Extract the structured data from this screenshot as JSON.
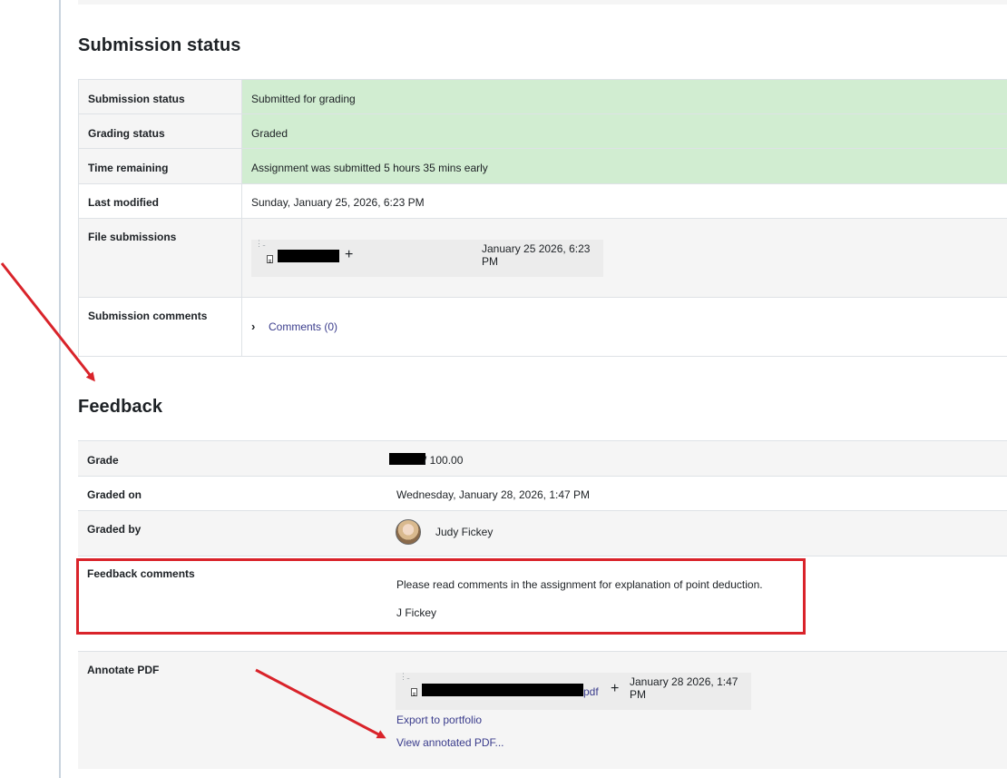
{
  "submission": {
    "heading": "Submission status",
    "rows": {
      "status_label": "Submission status",
      "status_value": "Submitted for grading",
      "grading_label": "Grading status",
      "grading_value": "Graded",
      "time_label": "Time remaining",
      "time_value": "Assignment was submitted 5 hours 35 mins early",
      "modified_label": "Last modified",
      "modified_value": "Sunday, January 25, 2026, 6:23 PM",
      "files_label": "File submissions",
      "file_date": "January 25 2026, 6:23 PM",
      "comments_label": "Submission comments",
      "comments_link": "Comments (0)"
    }
  },
  "feedback": {
    "heading": "Feedback",
    "rows": {
      "grade_label": "Grade",
      "grade_value": "/ 100.00",
      "graded_on_label": "Graded on",
      "graded_on_value": "Wednesday, January 28, 2026, 1:47 PM",
      "graded_by_label": "Graded by",
      "graded_by_value": "Judy Fickey",
      "comments_label": "Feedback comments",
      "comments_line1": "Please read comments in the assignment for explanation of point deduction.",
      "comments_line2": "J Fickey",
      "annotate_label": "Annotate PDF",
      "annotate_file_ext": "pdf",
      "annotate_file_date": "January 28 2026, 1:47 PM",
      "export_link": "Export to portfolio",
      "view_link": "View annotated PDF..."
    }
  },
  "icons": {
    "file": "file-icon",
    "plus": "plus-icon",
    "chevron": "chevron-right-icon",
    "avatar": "avatar"
  },
  "colors": {
    "highlight_green": "#d1edd1",
    "annotation_red": "#d9232a",
    "link": "#3a3c8c"
  }
}
